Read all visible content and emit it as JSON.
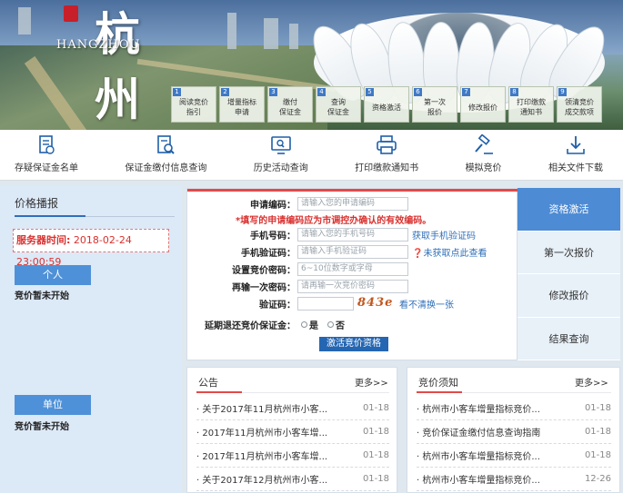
{
  "banner": {
    "logo_en": "HANGZHOU",
    "logo_cn": "杭州",
    "steps": [
      {
        "num": "1",
        "label": "阅读竞价\n指引"
      },
      {
        "num": "2",
        "label": "增量指标\n申请"
      },
      {
        "num": "3",
        "label": "缴付\n保证金"
      },
      {
        "num": "4",
        "label": "查询\n保证金"
      },
      {
        "num": "5",
        "label": "资格激活"
      },
      {
        "num": "6",
        "label": "第一次\n报价"
      },
      {
        "num": "7",
        "label": "修改报价"
      },
      {
        "num": "8",
        "label": "打印缴款\n通知书"
      },
      {
        "num": "9",
        "label": "领清竞价\n成交款项"
      }
    ]
  },
  "toolbar": [
    {
      "icon": "document-icon",
      "label": "存疑保证金名单"
    },
    {
      "icon": "search-document-icon",
      "label": "保证金缴付信息查询"
    },
    {
      "icon": "monitor-search-icon",
      "label": "历史活动查询"
    },
    {
      "icon": "printer-icon",
      "label": "打印缴款通知书"
    },
    {
      "icon": "gavel-icon",
      "label": "模拟竞价"
    },
    {
      "icon": "download-icon",
      "label": "相关文件下载"
    }
  ],
  "left": {
    "title": "价格播报",
    "server_label": "服务器时间:",
    "server_time": "2018-02-24 23:00:59",
    "personal_btn": "个人",
    "personal_status": "竞价暂未开始",
    "company_btn": "单位",
    "company_status": "竞价暂未开始"
  },
  "form": {
    "app_code_label": "申请编码：",
    "app_code_placeholder": "请输入您的申请编码",
    "warning": "*填写的申请编码应为市调控办确认的有效编码。",
    "phone_label": "手机号码：",
    "phone_placeholder": "请输入您的手机号码",
    "phone_link": "获取手机验证码",
    "sms_label": "手机验证码：",
    "sms_placeholder": "请输入手机验证码",
    "sms_link": "❓未获取点此查看",
    "pwd_label": "设置竞价密码：",
    "pwd_placeholder": "6~10位数字或字母",
    "pwd2_label": "再输一次密码：",
    "pwd2_placeholder": "请再输一次竞价密码",
    "captcha_label": "验证码：",
    "captcha_value": "",
    "captcha_image_text": "843e",
    "captcha_link": "看不清换一张",
    "refund_label": "延期退还竞价保证金：",
    "radio_yes": "是",
    "radio_no": "否",
    "submit": "激活竞价资格"
  },
  "tabs": [
    {
      "label": "资格激活",
      "active": true
    },
    {
      "label": "第一次报价",
      "active": false
    },
    {
      "label": "修改报价",
      "active": false
    },
    {
      "label": "结果查询",
      "active": false
    }
  ],
  "notices": {
    "title": "公告",
    "more": "更多>>",
    "items": [
      {
        "text": "· 关于2017年11月杭州市小客...",
        "date": "01-18"
      },
      {
        "text": "· 2017年11月杭州市小客车增...",
        "date": "01-18"
      },
      {
        "text": "· 2017年11月杭州市小客车增...",
        "date": "01-18"
      },
      {
        "text": "· 关于2017年12月杭州市小客...",
        "date": "01-18"
      }
    ]
  },
  "guide": {
    "title": "竞价须知",
    "more": "更多>>",
    "items": [
      {
        "text": "· 杭州市小客车增量指标竞价...",
        "date": "01-18"
      },
      {
        "text": "· 竞价保证金缴付信息查询指南",
        "date": "01-18"
      },
      {
        "text": "· 杭州市小客车增量指标竞价...",
        "date": "01-18"
      },
      {
        "text": "· 杭州市小客车增量指标竞价...",
        "date": "12-26"
      }
    ]
  },
  "colors": {
    "accent": "#4d8bd4",
    "warning": "#d9312f",
    "submit": "#2466b2"
  }
}
